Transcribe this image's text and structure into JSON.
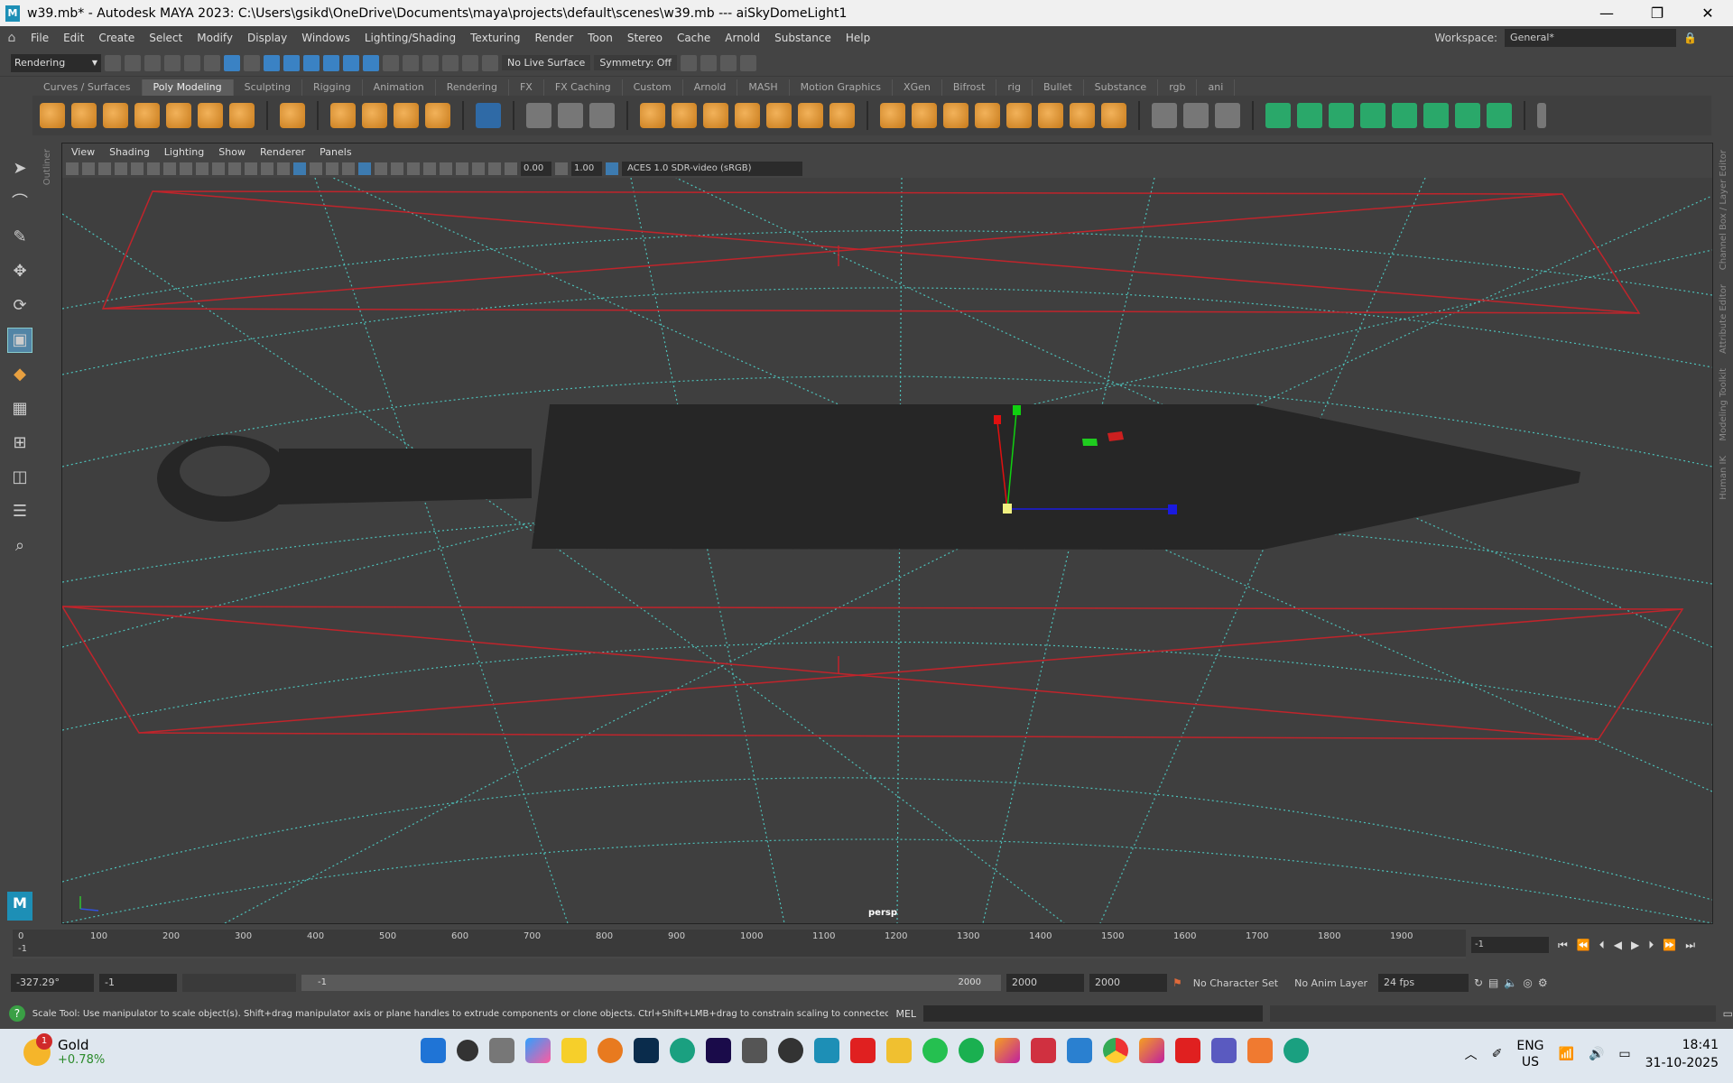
{
  "window": {
    "title": "w39.mb* - Autodesk MAYA 2023: C:\\Users\\gsikd\\OneDrive\\Documents\\maya\\projects\\default\\scenes\\w39.mb   ---   aiSkyDomeLight1",
    "app_icon": "M",
    "minimize": "—",
    "restore": "❐",
    "close": "✕"
  },
  "menubar": {
    "items": [
      "File",
      "Edit",
      "Create",
      "Select",
      "Modify",
      "Display",
      "Windows",
      "Lighting/Shading",
      "Texturing",
      "Render",
      "Toon",
      "Stereo",
      "Cache",
      "Arnold",
      "Substance",
      "Help"
    ],
    "workspace_label": "Workspace:",
    "workspace_value": "General*"
  },
  "statusline": {
    "mode": "Rendering",
    "live_surface": "No Live Surface",
    "symmetry": "Symmetry: Off"
  },
  "shelf": {
    "tabs": [
      "Curves / Surfaces",
      "Poly Modeling",
      "Sculpting",
      "Rigging",
      "Animation",
      "Rendering",
      "FX",
      "FX Caching",
      "Custom",
      "Arnold",
      "MASH",
      "Motion Graphics",
      "XGen",
      "Bifrost",
      "rig",
      "Bullet",
      "Substance",
      "rgb",
      "ani"
    ],
    "active_tab": "Poly Modeling"
  },
  "outliner_tab": "Outliner",
  "panel": {
    "menus": [
      "View",
      "Shading",
      "Lighting",
      "Show",
      "Renderer",
      "Panels"
    ],
    "exposure": "0.00",
    "gamma": "1.00",
    "color_space": "ACES 1.0 SDR-video (sRGB)",
    "camera_label": "persp"
  },
  "right_tabs": [
    "Channel Box / Layer Editor",
    "Attribute Editor",
    "Modeling Toolkit",
    "Human IK"
  ],
  "timeline": {
    "ticks": [
      "0",
      "100",
      "200",
      "300",
      "400",
      "500",
      "600",
      "700",
      "800",
      "900",
      "1000",
      "1100",
      "1200",
      "1300",
      "1400",
      "1500",
      "1600",
      "1700",
      "1800",
      "1900"
    ],
    "current_frame_marker": "-1",
    "current_frame_field": "-1"
  },
  "range": {
    "rotation_readout": "-327.29°",
    "start": "-1",
    "bar_start": "-1",
    "bar_end": "2000",
    "end": "2000",
    "max_end": "2000",
    "character_set": "No Character Set",
    "anim_layer": "No Anim Layer",
    "fps": "24 fps"
  },
  "helpline": {
    "text": "Scale Tool: Use manipulator to scale object(s). Shift+drag manipulator axis or plane handles to extrude components or clone objects. Ctrl+Shift+LMB+drag to constrain scaling to connected edges. Use D or INSERT",
    "mel_label": "MEL"
  },
  "taskbar": {
    "weather_badge": "1",
    "weather_title": "Gold",
    "weather_change": "+0.78%",
    "lang_top": "ENG",
    "lang_bottom": "US",
    "time": "18:41",
    "date": "31-10-2025"
  },
  "colors": {
    "viewport_bg": "#3f3f3f",
    "grid_cyan": "#4fd0c8",
    "light_red": "#c0242b",
    "mesh": "#262626",
    "axis_x": "#e01010",
    "axis_y": "#10d010",
    "axis_z": "#1a1adf",
    "accent": "#1d8fb6"
  }
}
